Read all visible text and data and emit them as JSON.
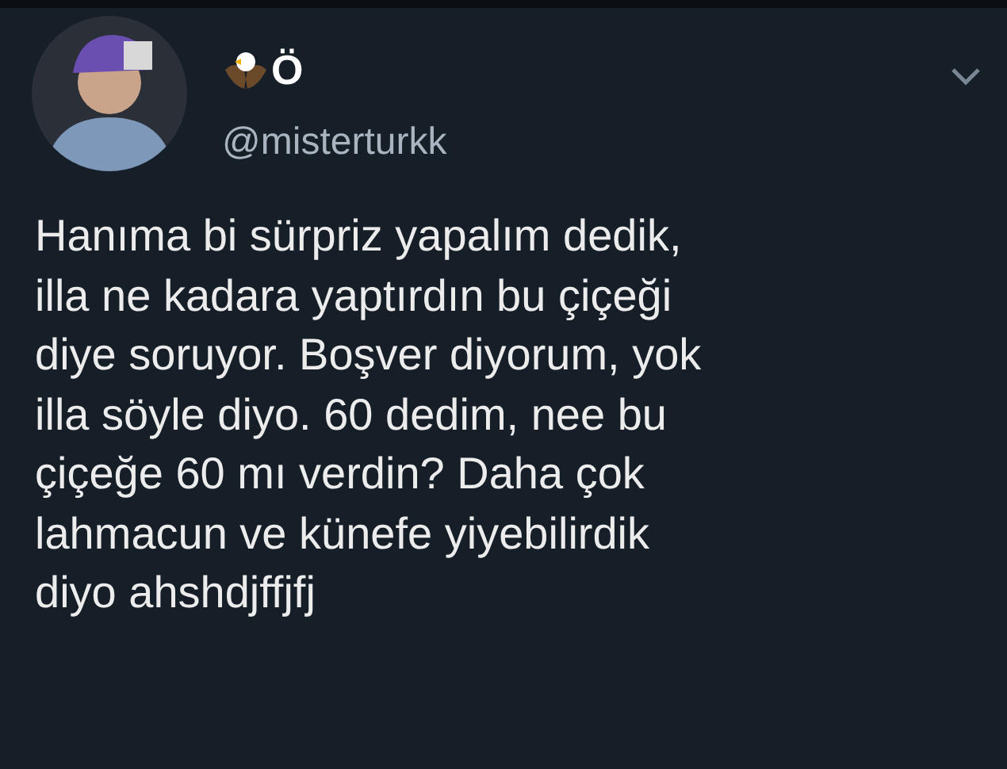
{
  "tweet": {
    "display_name": "Ö",
    "handle": "@misterturkk",
    "text": "Hanıma bi sürpriz yapalım dedik,\nilla ne kadara yaptırdın bu çiçeği\ndiye soruyor. Boşver diyorum, yok\nilla söyle diyo. 60 dedim, nee bu\nçiçeğe 60 mı verdin? Daha çok\nlahmacun ve künefe yiyebilirdik\ndiyo ahshdjffjfj"
  }
}
